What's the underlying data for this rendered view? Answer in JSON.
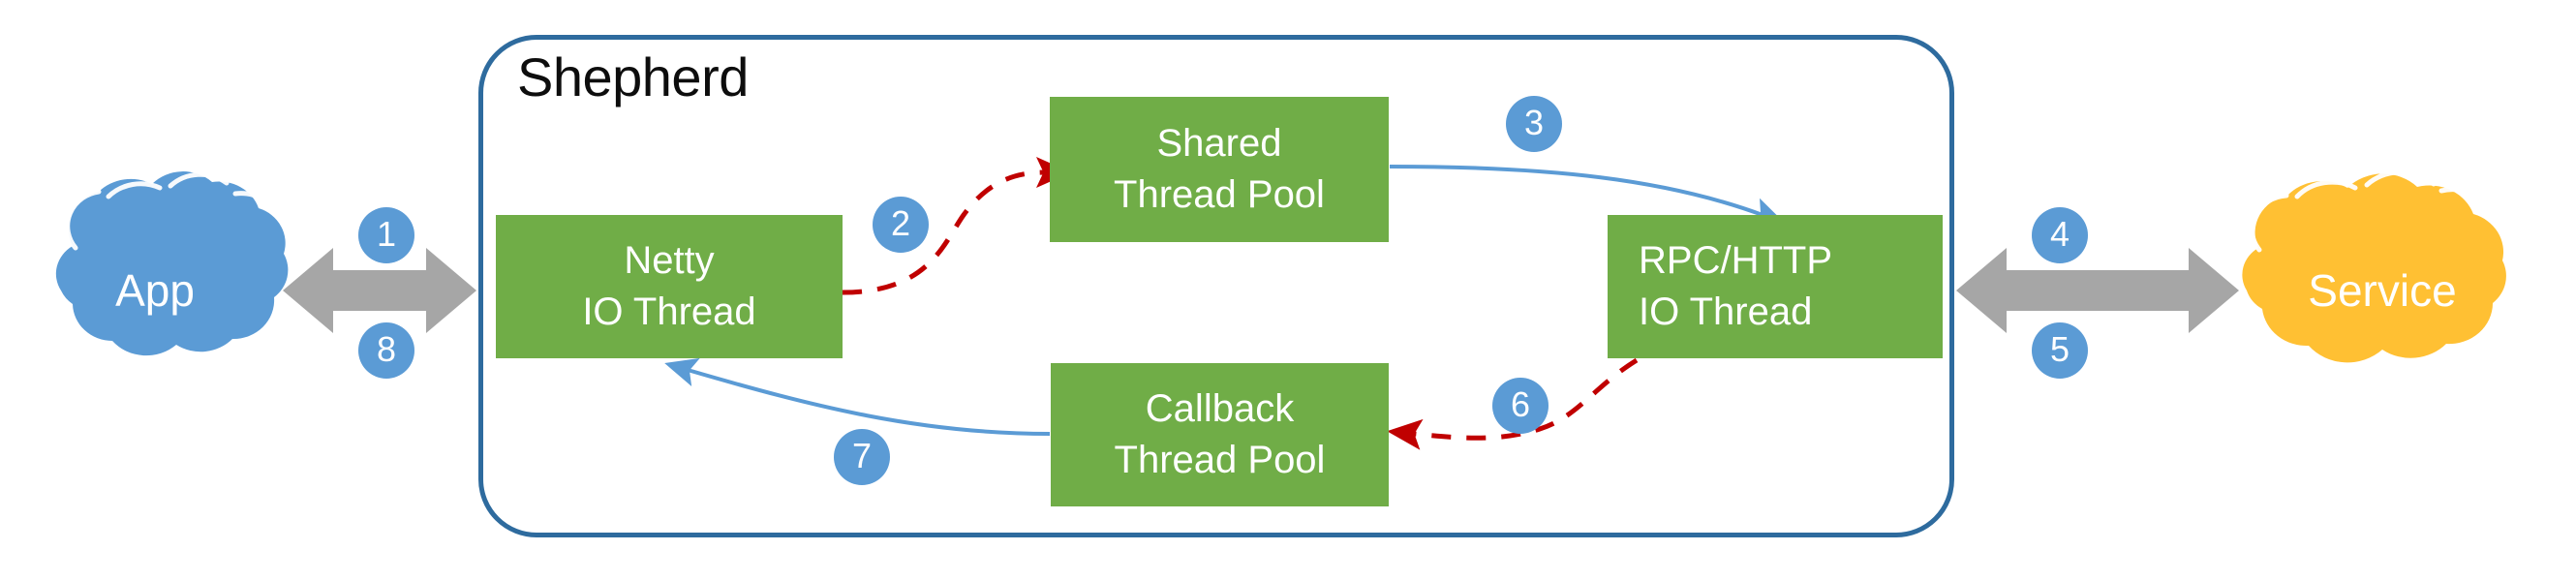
{
  "diagram": {
    "title": "Shepherd",
    "type": "architecture-flow",
    "background_color": "#FFFFFF",
    "palette": {
      "container_border": "#2E6B9E",
      "process_box": "#70AD47",
      "process_text": "#FFFFFF",
      "app_cloud": "#5B9BD5",
      "service_cloud": "#FFC033",
      "badge": "#5B9BD5",
      "badge_text": "#FFFFFF",
      "gray_arrow": "#A6A6A6",
      "blue_arrow": "#5B9BD5",
      "red_dashed_arrow": "#C00000",
      "title_text": "#0D0D0D"
    }
  },
  "container": {
    "label": "Shepherd"
  },
  "clouds": [
    {
      "id": "app",
      "label": "App",
      "color": "#5B9BD5"
    },
    {
      "id": "service",
      "label": "Service",
      "color": "#FFC033"
    }
  ],
  "boxes": [
    {
      "id": "netty",
      "line1": "Netty",
      "line2": "IO Thread",
      "color": "#70AD47"
    },
    {
      "id": "shared",
      "line1": "Shared",
      "line2": "Thread Pool",
      "color": "#70AD47"
    },
    {
      "id": "rpc",
      "line1": "RPC/HTTP",
      "line2": "IO Thread",
      "color": "#70AD47"
    },
    {
      "id": "callback",
      "line1": "Callback",
      "line2": "Thread Pool",
      "color": "#70AD47"
    }
  ],
  "steps": [
    {
      "number": "1",
      "from": "App",
      "to": "Netty IO Thread",
      "style": "gray-double-arrow"
    },
    {
      "number": "2",
      "from": "Netty IO Thread",
      "to": "Shared Thread Pool",
      "style": "red-dashed-arrow"
    },
    {
      "number": "3",
      "from": "Shared Thread Pool",
      "to": "RPC/HTTP IO Thread",
      "style": "blue-curved-arrow"
    },
    {
      "number": "4",
      "from": "RPC/HTTP IO Thread",
      "to": "Service",
      "style": "gray-double-arrow"
    },
    {
      "number": "5",
      "from": "Service",
      "to": "RPC/HTTP IO Thread",
      "style": "gray-double-arrow"
    },
    {
      "number": "6",
      "from": "RPC/HTTP IO Thread",
      "to": "Callback Thread Pool",
      "style": "red-dashed-arrow"
    },
    {
      "number": "7",
      "from": "Callback Thread Pool",
      "to": "Netty IO Thread",
      "style": "blue-curved-arrow"
    },
    {
      "number": "8",
      "from": "Netty IO Thread",
      "to": "App",
      "style": "gray-double-arrow"
    }
  ]
}
